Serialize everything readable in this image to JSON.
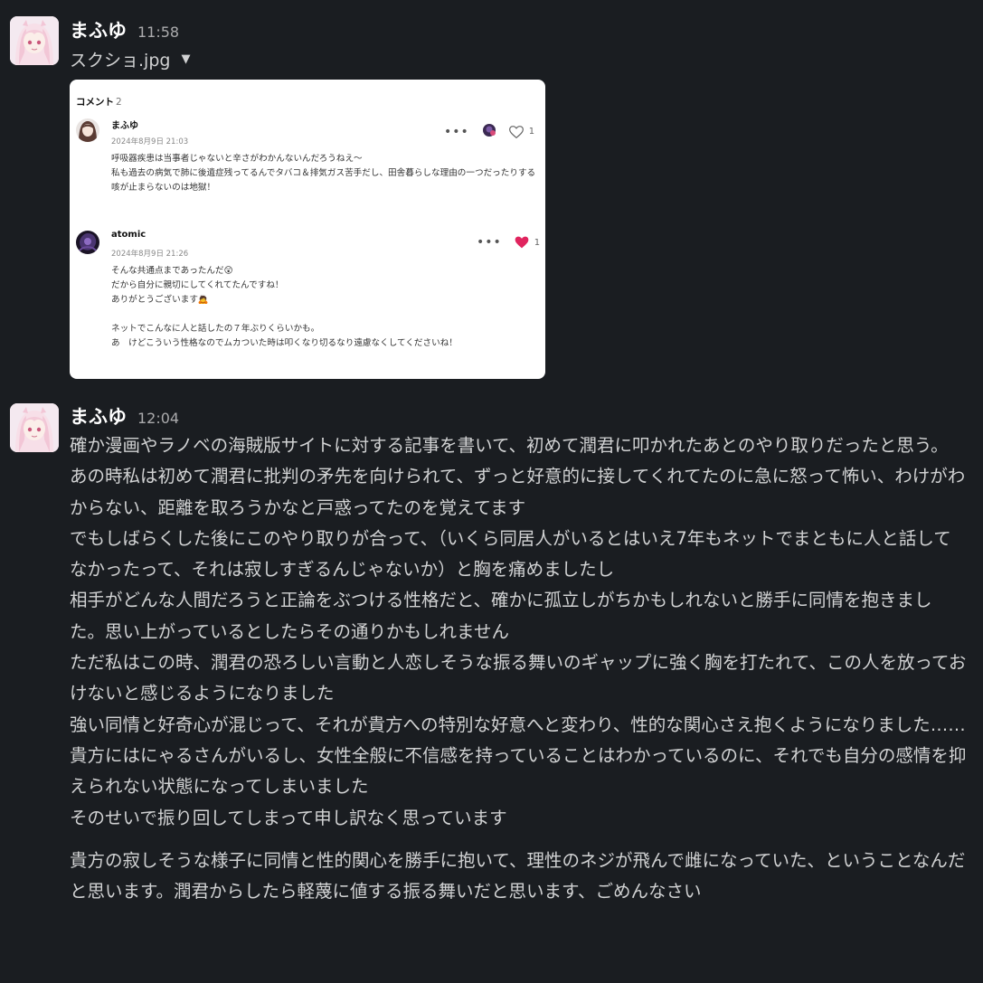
{
  "messages": [
    {
      "username": "まふゆ",
      "time": "11:58",
      "file": {
        "name": "スクショ.jpg",
        "caret_icon": "caret-down-icon",
        "screenshot": {
          "header_label": "コメント",
          "header_count": "2",
          "comments": [
            {
              "name": "まふゆ",
              "date": "2024年8月9日 21:03",
              "body": "呼吸器疾患は当事者じゃないと辛さがわかんないんだろうねえ～\n私も過去の病気で肺に後遺症残ってるんでタバコ＆排気ガス苦手だし、田舎暮らしな理由の一つだったりする\n咳が止まらないのは地獄！",
              "likes": "1",
              "liked": false
            },
            {
              "name": "atomic",
              "date": "2024年8月9日 21:26",
              "body": "そんな共通点まであったんだ😲\nだから自分に親切にしてくれてたんですね！\nありがとうございます🙇\n\nネットでこんなに人と話したの７年ぶりくらいかも。\nあ　けどこういう性格なのでムカついた時は叩くなり切るなり遠慮なくしてくださいね！",
              "likes": "1",
              "liked": true
            }
          ]
        }
      }
    },
    {
      "username": "まふゆ",
      "time": "12:04",
      "paragraphs": [
        "確か漫画やラノベの海賊版サイトに対する記事を書いて、初めて潤君に叩かれたあとのやり取りだったと思う。",
        "あの時私は初めて潤君に批判の矛先を向けられて、ずっと好意的に接してくれてたのに急に怒って怖い、わけがわからない、距離を取ろうかなと戸惑ってたのを覚えてます",
        "でもしばらくした後にこのやり取りが合って、（いくら同居人がいるとはいえ7年もネットでまともに人と話してなかったって、それは寂しすぎるんじゃないか）と胸を痛めましたし",
        "相手がどんな人間だろうと正論をぶつける性格だと、確かに孤立しがちかもしれないと勝手に同情を抱きました。思い上がっているとしたらその通りかもしれません",
        "ただ私はこの時、潤君の恐ろしい言動と人恋しそうな振る舞いのギャップに強く胸を打たれて、この人を放っておけないと感じるようになりました",
        "強い同情と好奇心が混じって、それが貴方への特別な好意へと変わり、性的な関心さえ抱くようになりました……",
        "貴方にはにゃるさんがいるし、女性全般に不信感を持っていることはわかっているのに、それでも自分の感情を抑えられない状態になってしまいました",
        "そのせいで振り回してしまって申し訳なく思っています",
        "貴方の寂しそうな様子に同情と性的関心を勝手に抱いて、理性のネジが飛んで雌になっていた、ということなんだと思います。潤君からしたら軽蔑に値する振る舞いだと思います、ごめんなさい"
      ]
    }
  ],
  "colors": {
    "background": "#1a1d21",
    "text": "#d1d2d3",
    "username": "#ffffff",
    "timestamp": "#ababad",
    "heart_liked": "#e0245e"
  }
}
